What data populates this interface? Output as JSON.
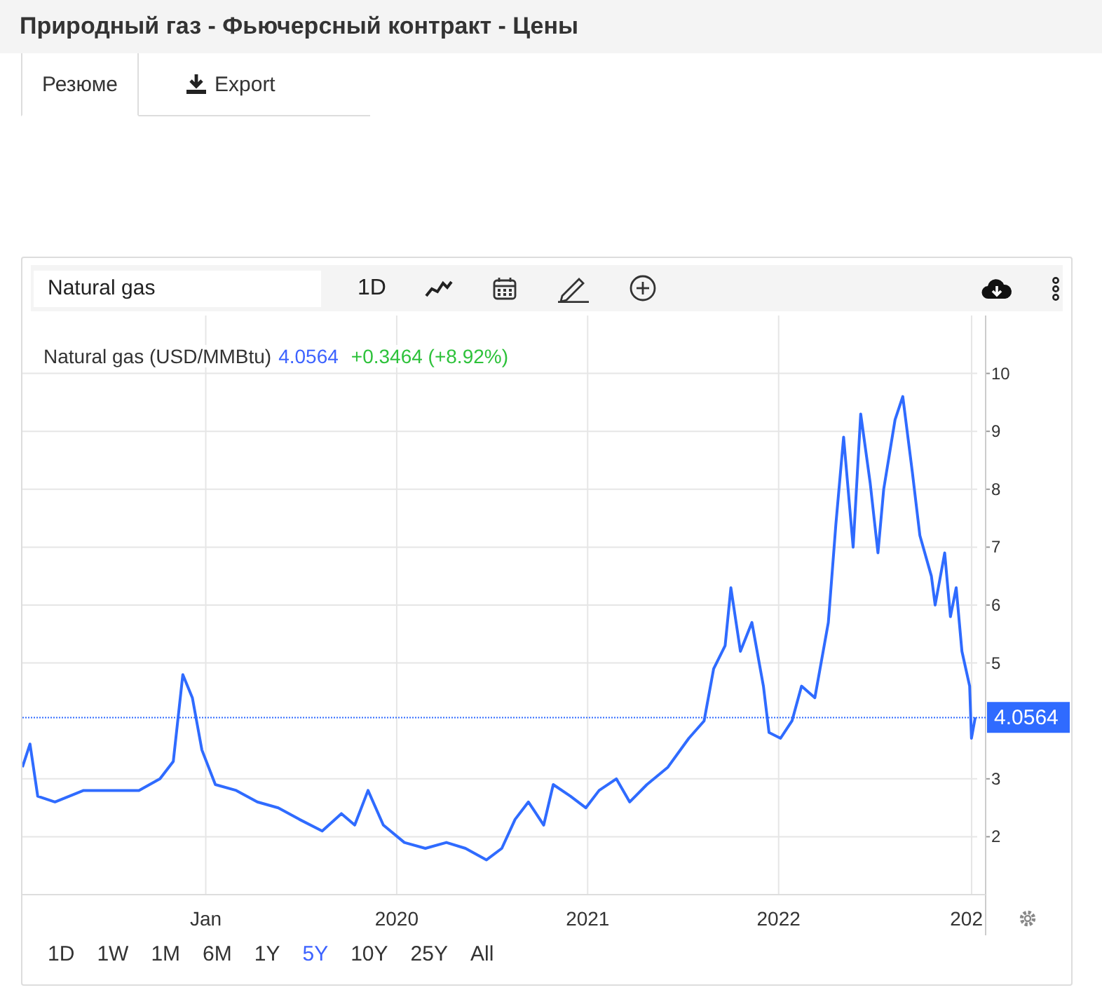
{
  "page_title": "Природный газ - Фьючерсный контракт - Цены",
  "tabs": [
    {
      "label": "Резюме",
      "selected": true,
      "kind": "text"
    },
    {
      "label": "Export",
      "selected": false,
      "kind": "download"
    }
  ],
  "chart_widget": {
    "symbol_field": {
      "value": "Natural gas"
    },
    "interval": "1D",
    "legend": {
      "price": "4.0564",
      "change": "+0.3464 (+8.92%)"
    },
    "cut_axis_label": "202",
    "price_tag": "4.0564",
    "chart_data": {
      "type": "line",
      "xlim": [
        2018.04,
        2023.04
      ],
      "ylim": [
        1,
        11
      ],
      "grid": true,
      "ref_lines": [
        {
          "axis": "y",
          "value": 4.0564
        }
      ],
      "xticks": [
        {
          "value": 2019,
          "label": "Jan"
        },
        {
          "value": 2020,
          "label": "2020"
        },
        {
          "value": 2021,
          "label": "2021"
        },
        {
          "value": 2022,
          "label": "2022"
        }
      ],
      "yticks": [
        2,
        3,
        5,
        6,
        7,
        8,
        9,
        10
      ],
      "x": [
        2018.04,
        2018.08,
        2018.12,
        2018.21,
        2018.36,
        2018.5,
        2018.65,
        2018.76,
        2018.83,
        2018.88,
        2018.93,
        2018.98,
        2019.05,
        2019.16,
        2019.27,
        2019.38,
        2019.49,
        2019.61,
        2019.71,
        2019.78,
        2019.85,
        2019.93,
        2020.04,
        2020.15,
        2020.26,
        2020.36,
        2020.47,
        2020.55,
        2020.62,
        2020.69,
        2020.77,
        2020.82,
        2020.91,
        2020.99,
        2021.06,
        2021.15,
        2021.22,
        2021.31,
        2021.42,
        2021.53,
        2021.61,
        2021.66,
        2021.72,
        2021.75,
        2021.8,
        2021.86,
        2021.92,
        2021.95,
        2022.01,
        2022.07,
        2022.12,
        2022.19,
        2022.26,
        2022.3,
        2022.34,
        2022.39,
        2022.43,
        2022.48,
        2022.52,
        2022.55,
        2022.61,
        2022.65,
        2022.7,
        2022.74,
        2022.8,
        2022.82,
        2022.87,
        2022.9,
        2022.93,
        2022.96,
        2023.0,
        2023.01,
        2023.03
      ],
      "series": [
        {
          "name": "Natural gas (USD/MMBtu)",
          "color": "#2f6bff",
          "values": [
            3.2,
            3.6,
            2.7,
            2.6,
            2.8,
            2.8,
            2.8,
            3.0,
            3.3,
            4.8,
            4.4,
            3.5,
            2.9,
            2.8,
            2.6,
            2.5,
            2.3,
            2.1,
            2.4,
            2.2,
            2.8,
            2.2,
            1.9,
            1.8,
            1.9,
            1.8,
            1.6,
            1.8,
            2.3,
            2.6,
            2.2,
            2.9,
            2.7,
            2.5,
            2.8,
            3.0,
            2.6,
            2.9,
            3.2,
            3.7,
            4.0,
            4.9,
            5.3,
            6.3,
            5.2,
            5.7,
            4.6,
            3.8,
            3.7,
            4.0,
            4.6,
            4.4,
            5.7,
            7.4,
            8.9,
            7.0,
            9.3,
            8.1,
            6.9,
            8.0,
            9.2,
            9.6,
            8.3,
            7.2,
            6.5,
            6.0,
            6.9,
            5.8,
            6.3,
            5.2,
            4.6,
            3.7,
            4.06
          ]
        }
      ]
    },
    "ranges": [
      {
        "label": "1D",
        "selected": false
      },
      {
        "label": "1W",
        "selected": false
      },
      {
        "label": "1M",
        "selected": false
      },
      {
        "label": "6M",
        "selected": false
      },
      {
        "label": "1Y",
        "selected": false
      },
      {
        "label": "5Y",
        "selected": true
      },
      {
        "label": "10Y",
        "selected": false
      },
      {
        "label": "25Y",
        "selected": false
      },
      {
        "label": "All",
        "selected": false
      }
    ]
  }
}
